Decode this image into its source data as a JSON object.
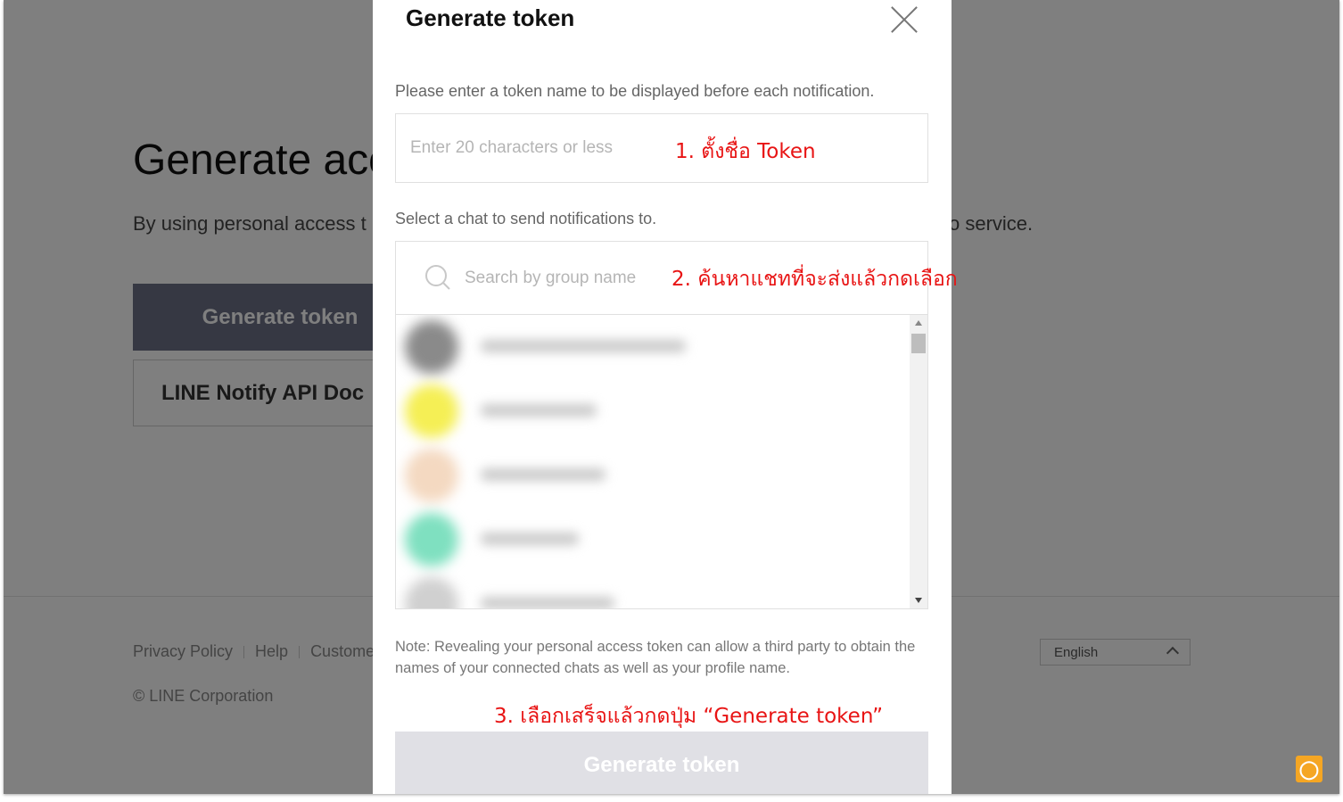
{
  "background": {
    "title": "Generate acc",
    "description_left": "By using personal access t",
    "description_right": "o service.",
    "generate_button": "Generate token",
    "docs_link": "LINE Notify API Doc",
    "footer": {
      "links": [
        "Privacy Policy",
        "Help",
        "Custome"
      ],
      "copyright": "© LINE Corporation",
      "language": "English"
    }
  },
  "modal": {
    "title": "Generate token",
    "instruction": "Please enter a token name to be displayed before each notification.",
    "token_input_placeholder": "Enter 20 characters or less",
    "select_label": "Select a chat to send notifications to.",
    "search_placeholder": "Search by group name",
    "note": "Note: Revealing your personal access token can allow a third party to obtain the names of your connected chats as well as your profile name.",
    "generate_button": "Generate token",
    "chat_list": [
      {
        "avatar_color": "#8a8a8a"
      },
      {
        "avatar_color": "#f5ef55"
      },
      {
        "avatar_color": "#f4d9c1"
      },
      {
        "avatar_color": "#7fe0c0"
      },
      {
        "avatar_color": "#d0d0d0"
      }
    ]
  },
  "annotations": {
    "step1": "1. ตั้งชื่อ Token",
    "step2": "2. ค้นหาแชทที่จะส่งแล้วกดเลือก",
    "step3": "3. เลือกเสร็จแล้วกดปุ่ม “Generate token”"
  }
}
